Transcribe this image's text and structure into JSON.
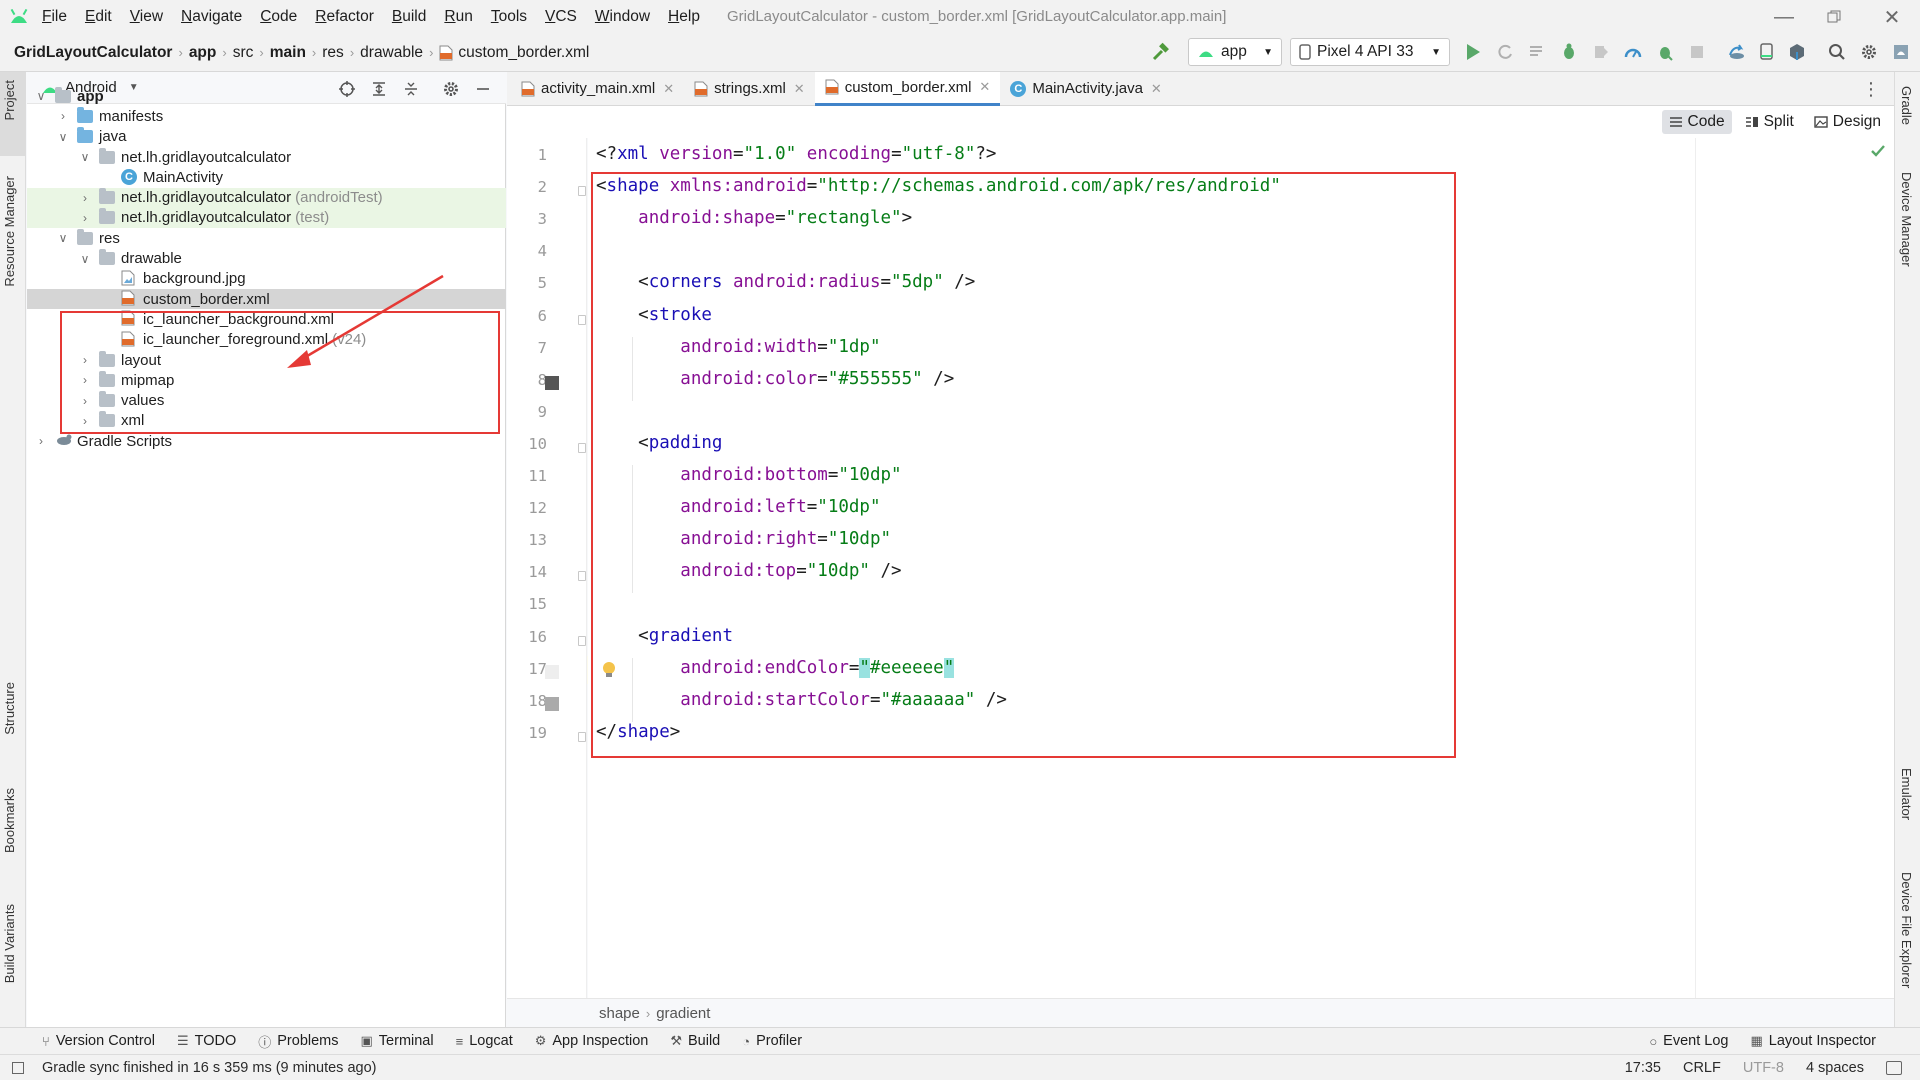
{
  "menu": {
    "items": [
      "File",
      "Edit",
      "View",
      "Navigate",
      "Code",
      "Refactor",
      "Build",
      "Run",
      "Tools",
      "VCS",
      "Window",
      "Help"
    ],
    "window_title": "GridLayoutCalculator - custom_border.xml [GridLayoutCalculator.app.main]"
  },
  "breadcrumb": [
    "GridLayoutCalculator",
    "app",
    "src",
    "main",
    "res",
    "drawable",
    "custom_border.xml"
  ],
  "toolbar": {
    "run_config": "app",
    "device": "Pixel 4 API 33"
  },
  "left_stripe": [
    "Project",
    "Resource Manager",
    "Structure",
    "Bookmarks",
    "Build Variants"
  ],
  "right_stripe": [
    "Gradle",
    "Device Manager",
    "Emulator",
    "Device File Explorer"
  ],
  "project": {
    "view_mode": "Android",
    "tree": [
      {
        "label": "app",
        "level": 0,
        "type": "module",
        "expanded": true
      },
      {
        "label": "manifests",
        "level": 1,
        "type": "folder-blue",
        "expanded": false
      },
      {
        "label": "java",
        "level": 1,
        "type": "folder-blue",
        "expanded": true
      },
      {
        "label": "net.lh.gridlayoutcalculator",
        "level": 2,
        "type": "package",
        "expanded": true
      },
      {
        "label": "MainActivity",
        "level": 3,
        "type": "class"
      },
      {
        "label": "net.lh.gridlayoutcalculator",
        "note": "(androidTest)",
        "level": 2,
        "type": "package",
        "expanded": false,
        "test": true
      },
      {
        "label": "net.lh.gridlayoutcalculator",
        "note": "(test)",
        "level": 2,
        "type": "package",
        "expanded": false,
        "test": true
      },
      {
        "label": "res",
        "level": 1,
        "type": "folder-gray",
        "expanded": true
      },
      {
        "label": "drawable",
        "level": 2,
        "type": "folder-gray",
        "expanded": true
      },
      {
        "label": "background.jpg",
        "level": 3,
        "type": "image"
      },
      {
        "label": "custom_border.xml",
        "level": 3,
        "type": "xml",
        "selected": true
      },
      {
        "label": "ic_launcher_background.xml",
        "level": 3,
        "type": "xml"
      },
      {
        "label": "ic_launcher_foreground.xml",
        "note": "(v24)",
        "level": 3,
        "type": "xml"
      },
      {
        "label": "layout",
        "level": 2,
        "type": "folder-gray",
        "expanded": false
      },
      {
        "label": "mipmap",
        "level": 2,
        "type": "folder-gray",
        "expanded": false
      },
      {
        "label": "values",
        "level": 2,
        "type": "folder-gray",
        "expanded": false
      },
      {
        "label": "xml",
        "level": 2,
        "type": "folder-gray",
        "expanded": false
      },
      {
        "label": "Gradle Scripts",
        "level": 0,
        "type": "gradle",
        "expanded": false
      }
    ]
  },
  "editor_tabs": [
    {
      "label": "activity_main.xml",
      "type": "xml",
      "active": false
    },
    {
      "label": "strings.xml",
      "type": "xml",
      "active": false
    },
    {
      "label": "custom_border.xml",
      "type": "xml",
      "active": true
    },
    {
      "label": "MainActivity.java",
      "type": "class",
      "active": false
    }
  ],
  "view_modes": [
    "Code",
    "Split",
    "Design"
  ],
  "code_lines": [
    [
      [
        "punct",
        "<?"
      ],
      [
        "tag",
        "xml "
      ],
      [
        "attr",
        "version"
      ],
      [
        "punct",
        "="
      ],
      [
        "val",
        "\"1.0\""
      ],
      [
        "punct",
        " "
      ],
      [
        "attr",
        "encoding"
      ],
      [
        "punct",
        "="
      ],
      [
        "val",
        "\"utf-8\""
      ],
      [
        "punct",
        "?>"
      ]
    ],
    [
      [
        "punct",
        "<"
      ],
      [
        "tag",
        "shape "
      ],
      [
        "attr",
        "xmlns:android"
      ],
      [
        "punct",
        "="
      ],
      [
        "val",
        "\"http://schemas.android.com/apk/res/android\""
      ]
    ],
    [
      [
        "punct",
        "    "
      ],
      [
        "attr",
        "android:shape"
      ],
      [
        "punct",
        "="
      ],
      [
        "val",
        "\"rectangle\""
      ],
      [
        "punct",
        ">"
      ]
    ],
    [],
    [
      [
        "punct",
        "    <"
      ],
      [
        "tag",
        "corners "
      ],
      [
        "attr",
        "android:radius"
      ],
      [
        "punct",
        "="
      ],
      [
        "val",
        "\"5dp\""
      ],
      [
        "punct",
        " />"
      ]
    ],
    [
      [
        "punct",
        "    <"
      ],
      [
        "tag",
        "stroke"
      ]
    ],
    [
      [
        "punct",
        "        "
      ],
      [
        "attr",
        "android:width"
      ],
      [
        "punct",
        "="
      ],
      [
        "val",
        "\"1dp\""
      ]
    ],
    [
      [
        "punct",
        "        "
      ],
      [
        "attr",
        "android:color"
      ],
      [
        "punct",
        "="
      ],
      [
        "val",
        "\"#555555\""
      ],
      [
        "punct",
        " />"
      ]
    ],
    [],
    [
      [
        "punct",
        "    <"
      ],
      [
        "tag",
        "padding"
      ]
    ],
    [
      [
        "punct",
        "        "
      ],
      [
        "attr",
        "android:bottom"
      ],
      [
        "punct",
        "="
      ],
      [
        "val",
        "\"10dp\""
      ]
    ],
    [
      [
        "punct",
        "        "
      ],
      [
        "attr",
        "android:left"
      ],
      [
        "punct",
        "="
      ],
      [
        "val",
        "\"10dp\""
      ]
    ],
    [
      [
        "punct",
        "        "
      ],
      [
        "attr",
        "android:right"
      ],
      [
        "punct",
        "="
      ],
      [
        "val",
        "\"10dp\""
      ]
    ],
    [
      [
        "punct",
        "        "
      ],
      [
        "attr",
        "android:top"
      ],
      [
        "punct",
        "="
      ],
      [
        "val",
        "\"10dp\""
      ],
      [
        "punct",
        " />"
      ]
    ],
    [],
    [
      [
        "punct",
        "    <"
      ],
      [
        "tag",
        "gradient"
      ]
    ],
    [
      [
        "punct",
        "        "
      ],
      [
        "attr",
        "android:endColor"
      ],
      [
        "punct",
        "="
      ],
      [
        "hl",
        "\""
      ],
      [
        "val",
        "#eeeeee"
      ],
      [
        "hl",
        "\""
      ]
    ],
    [
      [
        "punct",
        "        "
      ],
      [
        "attr",
        "android:startColor"
      ],
      [
        "punct",
        "="
      ],
      [
        "val",
        "\"#aaaaaa\""
      ],
      [
        "punct",
        " />"
      ]
    ],
    [
      [
        "punct",
        "</"
      ],
      [
        "tag",
        "shape"
      ],
      [
        "punct",
        ">"
      ]
    ]
  ],
  "highlighted_line": 17,
  "editor_breadcrumb": [
    "shape",
    "gradient"
  ],
  "tool_windows_left": [
    "Version Control",
    "TODO",
    "Problems",
    "Terminal",
    "Logcat",
    "App Inspection",
    "Build",
    "Profiler"
  ],
  "tool_windows_right": [
    "Event Log",
    "Layout Inspector"
  ],
  "status": {
    "message": "Gradle sync finished in 16 s 359 ms (9 minutes ago)",
    "position": "17:35",
    "line_sep": "CRLF",
    "encoding": "UTF-8",
    "indent": "4 spaces"
  },
  "colors": {
    "accent": "#4083c9",
    "annotation": "#e53935",
    "xml_tag": "#1a0fb5",
    "xml_attr": "#871094",
    "xml_value": "#067d17"
  }
}
